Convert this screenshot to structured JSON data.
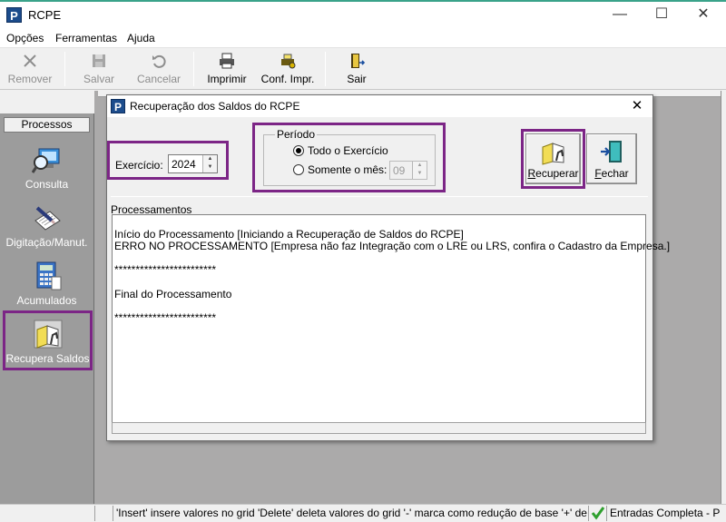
{
  "window": {
    "title": "RCPE",
    "icon_letter": "P",
    "minimize": "—",
    "maximize": "☐",
    "close": "✕"
  },
  "menu": {
    "items": [
      "Opções",
      "Ferramentas",
      "Ajuda"
    ]
  },
  "toolbar": {
    "buttons": [
      {
        "label": "Remover",
        "icon": "close-x-icon",
        "enabled": false
      },
      {
        "label": "Salvar",
        "icon": "floppy-disk-icon",
        "enabled": false
      },
      {
        "label": "Cancelar",
        "icon": "undo-icon",
        "enabled": false
      },
      {
        "label": "Imprimir",
        "icon": "printer-icon",
        "enabled": true
      },
      {
        "label": "Conf. Impr.",
        "icon": "printer-settings-icon",
        "enabled": true
      },
      {
        "label": "Sair",
        "icon": "exit-door-icon",
        "enabled": true
      }
    ]
  },
  "sidebar": {
    "header": "Processos",
    "items": [
      {
        "label": "Consulta",
        "icon": "magnifier-computer-icon"
      },
      {
        "label": "Digitação/Manut.",
        "icon": "pen-paper-icon"
      },
      {
        "label": "Acumulados",
        "icon": "calculator-icon"
      },
      {
        "label": "Recupera Saldos",
        "icon": "recover-folder-icon",
        "selected": true
      }
    ]
  },
  "dialog": {
    "title": "Recuperação dos Saldos do RCPE",
    "icon_letter": "P",
    "close": "✕",
    "exercicio": {
      "label": "Exercício:",
      "value": "2024"
    },
    "periodo": {
      "title": "Período",
      "option_all": "Todo o Exercício",
      "option_month": "Somente o mês:",
      "selected": "all",
      "month_value": "09"
    },
    "buttons": {
      "recuperar": "Recuperar",
      "fechar": "Fechar"
    },
    "processamentos": {
      "label": "Processamentos",
      "lines": [
        "Início do Processamento [Iniciando a Recuperação de Saldos do RCPE]",
        "ERRO NO PROCESSAMENTO [Empresa não faz Integração com o LRE ou LRS, confira o Cadastro da Empresa.]",
        "",
        "************************",
        "",
        "Final do Processamento",
        "",
        "************************"
      ]
    }
  },
  "statusbar": {
    "hint": "'Insert' insere valores no grid 'Delete' deleta valores do grid '-' marca como redução de base '+' desmarca re",
    "status": "Entradas Completa - P"
  },
  "colors": {
    "highlight": "#7c2586",
    "sidebar_bg": "#9c9c9c",
    "mdi_bg": "#abaaaa",
    "check_green": "#2ea02e"
  }
}
